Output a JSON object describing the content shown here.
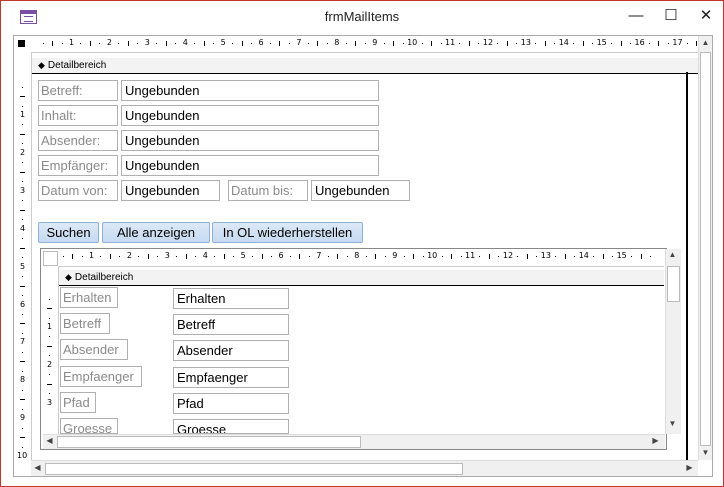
{
  "window": {
    "title": "frmMailItems",
    "minimize_glyph": "—",
    "maximize_glyph": "☐",
    "close_glyph": "✕"
  },
  "ruler": {
    "h_numbers": [
      "1",
      "2",
      "3",
      "4",
      "5",
      "6",
      "7",
      "8",
      "9",
      "10",
      "11",
      "12",
      "13",
      "14",
      "15",
      "16",
      "17"
    ],
    "v_numbers": [
      "1",
      "2",
      "3",
      "4",
      "5",
      "6",
      "7",
      "8",
      "9",
      "10"
    ],
    "sub_h_numbers": [
      "1",
      "2",
      "3",
      "4",
      "5",
      "6",
      "7",
      "8",
      "9",
      "10",
      "11",
      "12",
      "13",
      "14",
      "15"
    ],
    "sub_v_numbers": [
      "1",
      "2",
      "3"
    ]
  },
  "main_section": {
    "label": "Detailbereich",
    "icon": "section-marker-icon"
  },
  "fields": {
    "betreff_label": "Betreff:",
    "betreff_value": "Ungebunden",
    "inhalt_label": "Inhalt:",
    "inhalt_value": "Ungebunden",
    "absender_label": "Absender:",
    "absender_value": "Ungebunden",
    "empfaenger_label": "Empfänger:",
    "empfaenger_value": "Ungebunden",
    "datum_von_label": "Datum von:",
    "datum_von_value": "Ungebunden",
    "datum_bis_label": "Datum bis:",
    "datum_bis_value": "Ungebunden"
  },
  "buttons": {
    "suchen": "Suchen",
    "alle_anzeigen": "Alle anzeigen",
    "wiederherstellen": "In OL wiederherstellen"
  },
  "subform": {
    "section_label": "Detailbereich",
    "rows": [
      {
        "label": "Erhalten",
        "value": "Erhalten"
      },
      {
        "label": "Betreff",
        "value": "Betreff"
      },
      {
        "label": "Absender",
        "value": "Absender"
      },
      {
        "label": "Empfaenger",
        "value": "Empfaenger"
      },
      {
        "label": "Pfad",
        "value": "Pfad"
      },
      {
        "label": "Groesse",
        "value": "Groesse"
      }
    ]
  },
  "colors": {
    "accent_border": "#c0392b",
    "button_fill": "#c6daf1"
  }
}
